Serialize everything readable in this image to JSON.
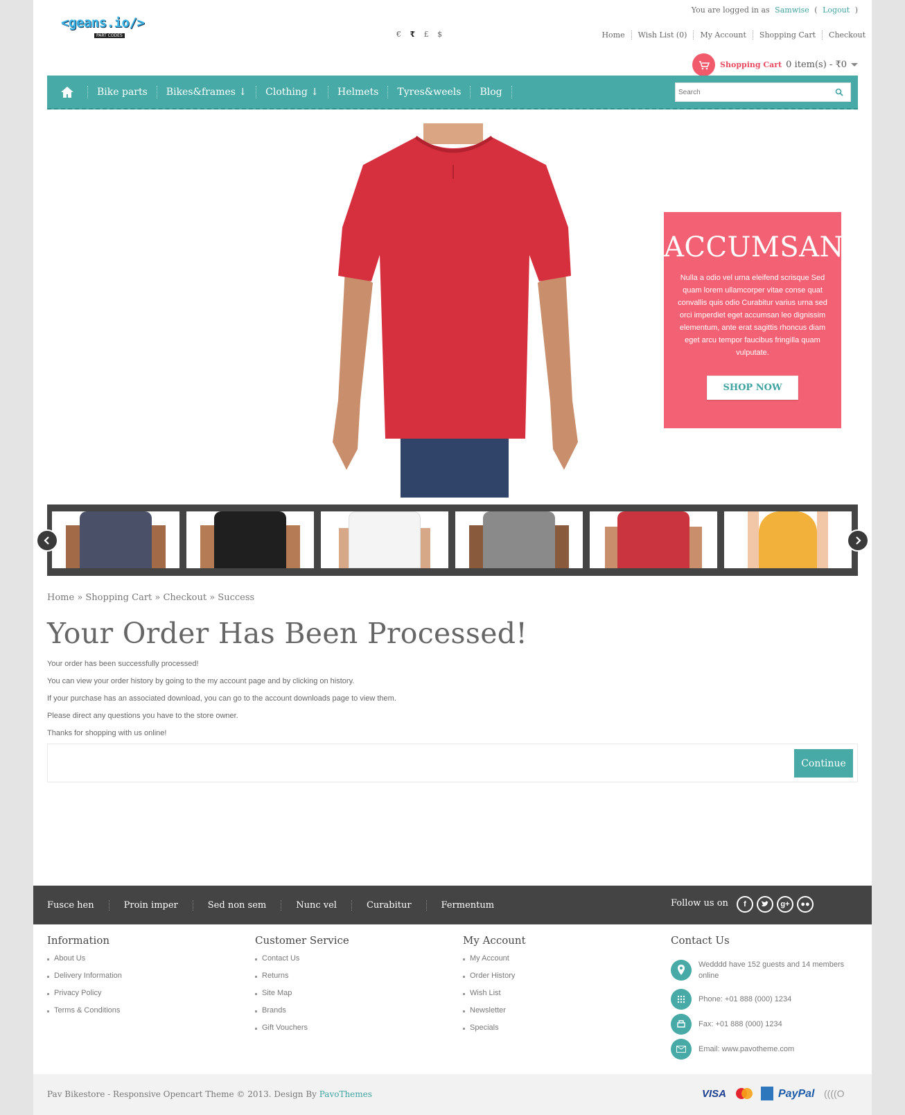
{
  "header": {
    "logo": "<geans.io/>",
    "logo_sub": "PART CODES",
    "login_prefix": "You are logged in as",
    "username": "Samwise",
    "logout_open": "(",
    "logout": "Logout",
    "logout_close": ")",
    "currencies": [
      "€",
      "₹",
      "£",
      "$"
    ],
    "selected_currency": "₹",
    "top_links": [
      "Home",
      "Wish List (0)",
      "My Account",
      "Shopping Cart",
      "Checkout"
    ],
    "cart_label": "Shopping Cart",
    "cart_summary": "0 item(s) - ₹0"
  },
  "nav": {
    "home_icon": "home-icon",
    "items": [
      "Bike parts",
      "Bikes&frames ↓",
      "Clothing ↓",
      "Helmets",
      "Tyres&weels",
      "Blog"
    ],
    "search_placeholder": "Search"
  },
  "hero": {
    "promo_title": "ACCUMSAN",
    "promo_text": "Nulla a odio vel urna eleifend scrisque Sed quam lorem ullamcorper vitae conse quat convallis quis odio Curabitur varius urna sed orci imperdiet eget accumsan leo dignissim elementum, ante erat sagittis rhoncus diam eget arcu tempor faucibus fringilla quam vulputate.",
    "promo_button": "SHOP NOW"
  },
  "thumbnails": {
    "colors": [
      "#4a5068",
      "#1f1f1f",
      "#f4f4f4",
      "#8a8a8a",
      "#c9343f",
      "#f2b13a"
    ]
  },
  "main": {
    "breadcrumb": "Home » Shopping Cart » Checkout » Success",
    "title": "Your Order Has Been Processed!",
    "messages": [
      "Your order has been successfully processed!",
      "You can view your order history by going to the my account page and by clicking on history.",
      "If your purchase has an associated download, you can go to the account downloads page to view them.",
      "Please direct any questions you have to the store owner.",
      "Thanks for shopping with us online!"
    ],
    "continue_button": "Continue"
  },
  "footer": {
    "links": [
      "Fusce hen",
      "Proin imper",
      "Sed non sem",
      "Nunc vel",
      "Curabitur",
      "Fermentum"
    ],
    "follow": "Follow us on",
    "social": [
      "facebook-icon",
      "twitter-icon",
      "google-plus-icon",
      "flickr-icon"
    ],
    "columns": [
      {
        "title": "Information",
        "items": [
          "About Us",
          "Delivery Information",
          "Privacy Policy",
          "Terms & Conditions"
        ]
      },
      {
        "title": "Customer Service",
        "items": [
          "Contact Us",
          "Returns",
          "Site Map",
          "Brands",
          "Gift Vouchers"
        ]
      },
      {
        "title": "My Account",
        "items": [
          "My Account",
          "Order History",
          "Wish List",
          "Newsletter",
          "Specials"
        ]
      }
    ],
    "contact_title": "Contact Us",
    "contact": [
      "Wedddd have 152 guests and 14 members online",
      "Phone: +01 888 (000) 1234",
      "Fax: +01 888 (000) 1234",
      "Email: www.pavotheme.com"
    ],
    "copyright_prefix": "Pav Bikestore - Responsive Opencart Theme © 2013. Design By",
    "copyright_brand": "PavoThemes",
    "payments": [
      "VISA",
      "MasterCard",
      "AmEx",
      "PayPal",
      "((((O"
    ]
  },
  "colors": {
    "accent": "#48aaa6",
    "promo": "#f36274",
    "dark_bar": "#444444"
  }
}
